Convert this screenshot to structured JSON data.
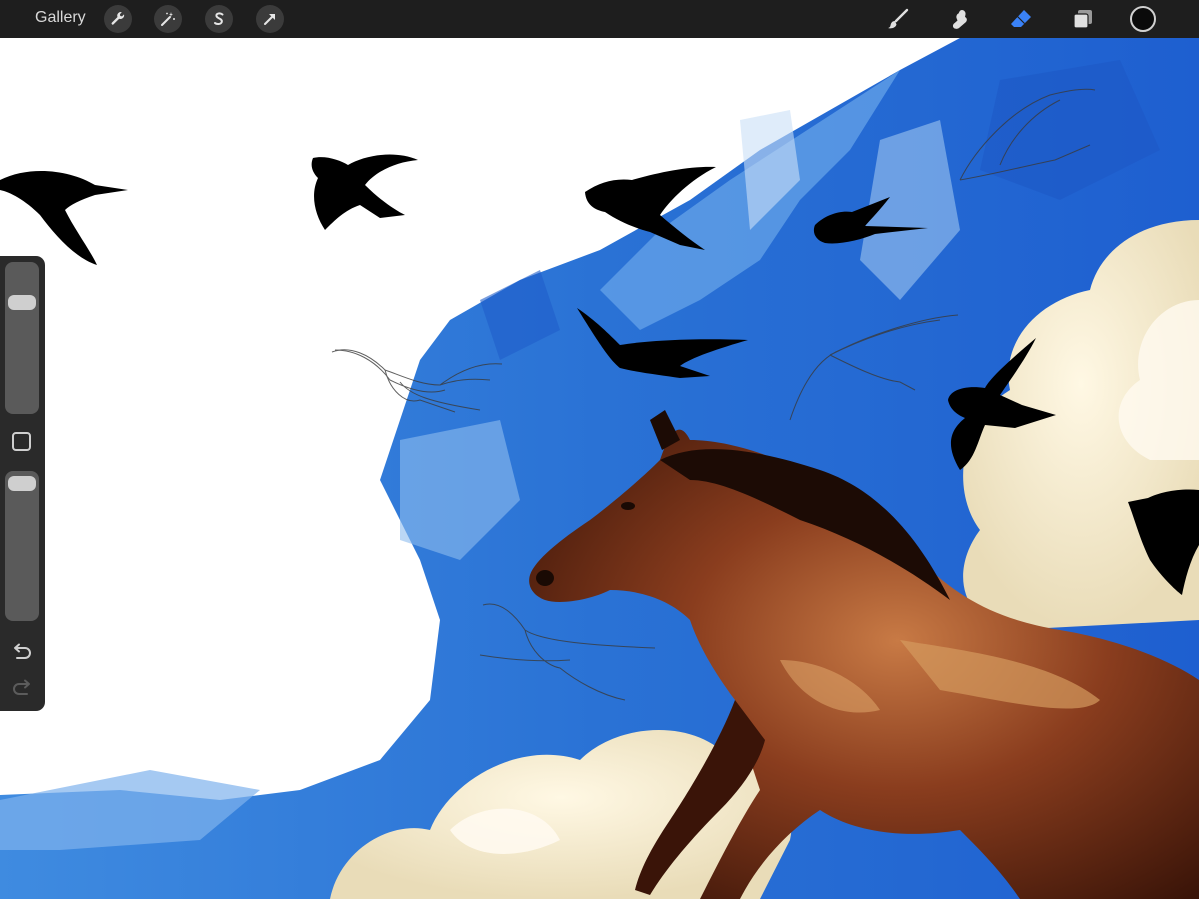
{
  "toolbar": {
    "gallery_label": "Gallery",
    "left_tools": [
      {
        "icon": "wrench-icon",
        "name": "actions"
      },
      {
        "icon": "magic-wand-icon",
        "name": "adjustments"
      },
      {
        "icon": "selection-s-icon",
        "name": "selection"
      },
      {
        "icon": "transform-arrow-icon",
        "name": "transform"
      }
    ],
    "right_tools": [
      {
        "icon": "brush-icon",
        "name": "paint"
      },
      {
        "icon": "smudge-icon",
        "name": "smudge"
      },
      {
        "icon": "eraser-icon",
        "name": "erase",
        "active": true
      },
      {
        "icon": "layers-icon",
        "name": "layers"
      }
    ],
    "active_tool_color": "#3a82f7",
    "current_color": "#0a0a0a"
  },
  "sidebar": {
    "brush_size_level": 0.78,
    "opacity_level": 1.0
  },
  "canvas": {
    "subject": "painting",
    "palette": {
      "sky_blue": "#2f78d6",
      "light_blue": "#7fb2ec",
      "cloud_cream": "#f4ecd2",
      "horse_brown": "#6a2f1a",
      "bird_black": "#000000"
    }
  }
}
